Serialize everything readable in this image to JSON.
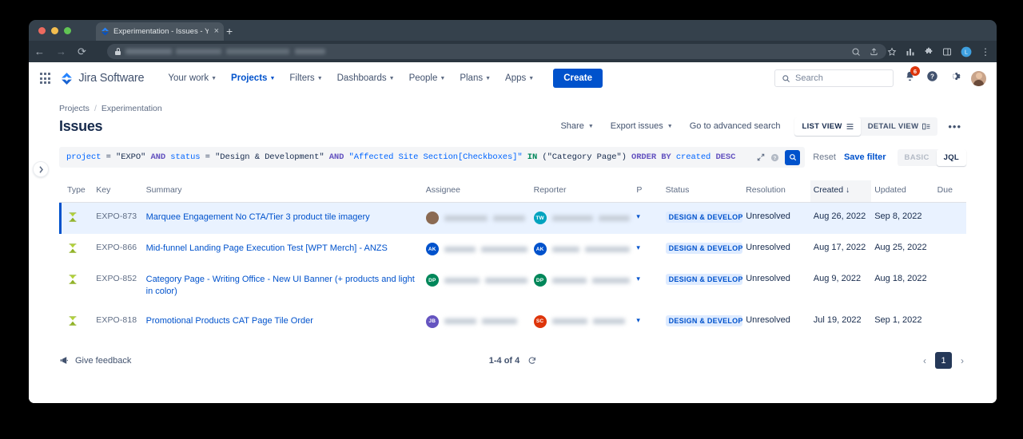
{
  "browser": {
    "tab_title": "Experimentation - Issues - You",
    "tab_close": "×",
    "new_tab": "+",
    "back": "←",
    "forward": "→",
    "reload": "⟳",
    "profile_initial": "L",
    "menu": "⋮"
  },
  "nav": {
    "product": "Jira Software",
    "items": [
      {
        "label": "Your work",
        "active": false
      },
      {
        "label": "Projects",
        "active": true
      },
      {
        "label": "Filters",
        "active": false
      },
      {
        "label": "Dashboards",
        "active": false
      },
      {
        "label": "People",
        "active": false
      },
      {
        "label": "Plans",
        "active": false
      },
      {
        "label": "Apps",
        "active": false
      }
    ],
    "create_label": "Create",
    "search_placeholder": "Search",
    "notification_count": "6"
  },
  "breadcrumb": {
    "project": "Projects",
    "separator": "/",
    "current": "Experimentation"
  },
  "page": {
    "title": "Issues"
  },
  "toolbar": {
    "share": "Share",
    "export": "Export issues",
    "advanced_search": "Go to advanced search",
    "list_view": "LIST VIEW",
    "detail_view": "DETAIL VIEW",
    "more": "•••"
  },
  "jql": {
    "tokens": [
      {
        "t": "project",
        "c": "k-field"
      },
      {
        "t": " = ",
        "c": "k-op"
      },
      {
        "t": "\"EXPO\"",
        "c": "k-str"
      },
      {
        "t": " AND ",
        "c": "k-and"
      },
      {
        "t": "status",
        "c": "k-field"
      },
      {
        "t": " = ",
        "c": "k-op"
      },
      {
        "t": "\"Design & Development\"",
        "c": "k-str"
      },
      {
        "t": " AND ",
        "c": "k-and"
      },
      {
        "t": "\"Affected Site Section[Checkboxes]\"",
        "c": "k-field"
      },
      {
        "t": " IN ",
        "c": "k-in"
      },
      {
        "t": "(\"Category Page\")",
        "c": "k-str"
      },
      {
        "t": " ORDER BY ",
        "c": "k-order"
      },
      {
        "t": "created",
        "c": "k-field"
      },
      {
        "t": " DESC",
        "c": "k-order"
      }
    ],
    "full_query": "project = \"EXPO\" AND status = \"Design & Development\" AND \"Affected Site Section[Checkboxes]\" IN (\"Category Page\") ORDER BY created DESC",
    "reset": "Reset",
    "save_filter": "Save filter",
    "mode_basic": "BASIC",
    "mode_jql": "JQL"
  },
  "table": {
    "headers": {
      "type": "Type",
      "key": "Key",
      "summary": "Summary",
      "assignee": "Assignee",
      "reporter": "Reporter",
      "p": "P",
      "status": "Status",
      "resolution": "Resolution",
      "created": "Created",
      "created_sort": "↓",
      "updated": "Updated",
      "due": "Due"
    },
    "rows": [
      {
        "key": "EXPO-873",
        "summary": "Marquee Engagement No CTA/Tier 3 product tile imagery",
        "assignee_initials": "",
        "assignee_color": "#8a6a52",
        "assignee_photo": true,
        "reporter_initials": "TW",
        "reporter_color": "#00a3bf",
        "status": "DESIGN & DEVELOPM",
        "resolution": "Unresolved",
        "created": "Aug 26, 2022",
        "updated": "Sep 8, 2022",
        "due": "",
        "selected": true
      },
      {
        "key": "EXPO-866",
        "summary": "Mid-funnel Landing Page Execution Test [WPT Merch] - ANZS",
        "assignee_initials": "AK",
        "assignee_color": "#0052cc",
        "assignee_photo": false,
        "reporter_initials": "AK",
        "reporter_color": "#0052cc",
        "status": "DESIGN & DEVELOPM",
        "resolution": "Unresolved",
        "created": "Aug 17, 2022",
        "updated": "Aug 25, 2022",
        "due": "",
        "selected": false
      },
      {
        "key": "EXPO-852",
        "summary": "Category Page - Writing Office - New UI Banner (+ products and light in color)",
        "assignee_initials": "DP",
        "assignee_color": "#00875a",
        "assignee_photo": false,
        "reporter_initials": "DP",
        "reporter_color": "#00875a",
        "status": "DESIGN & DEVELOPM",
        "resolution": "Unresolved",
        "created": "Aug 9, 2022",
        "updated": "Aug 18, 2022",
        "due": "",
        "selected": false
      },
      {
        "key": "EXPO-818",
        "summary": "Promotional Products CAT Page Tile Order",
        "assignee_initials": "JB",
        "assignee_color": "#6554c0",
        "assignee_photo": false,
        "reporter_initials": "SC",
        "reporter_color": "#de350b",
        "status": "DESIGN & DEVELOPM",
        "resolution": "Unresolved",
        "created": "Jul 19, 2022",
        "updated": "Sep 1, 2022",
        "due": "",
        "selected": false
      }
    ]
  },
  "footer": {
    "feedback": "Give feedback",
    "count": "1-4 of 4",
    "prev": "‹",
    "page": "1",
    "next": "›"
  },
  "colors": {
    "brand": "#0052cc",
    "status_bg": "#deebff",
    "selected_row": "#e9f2ff"
  }
}
